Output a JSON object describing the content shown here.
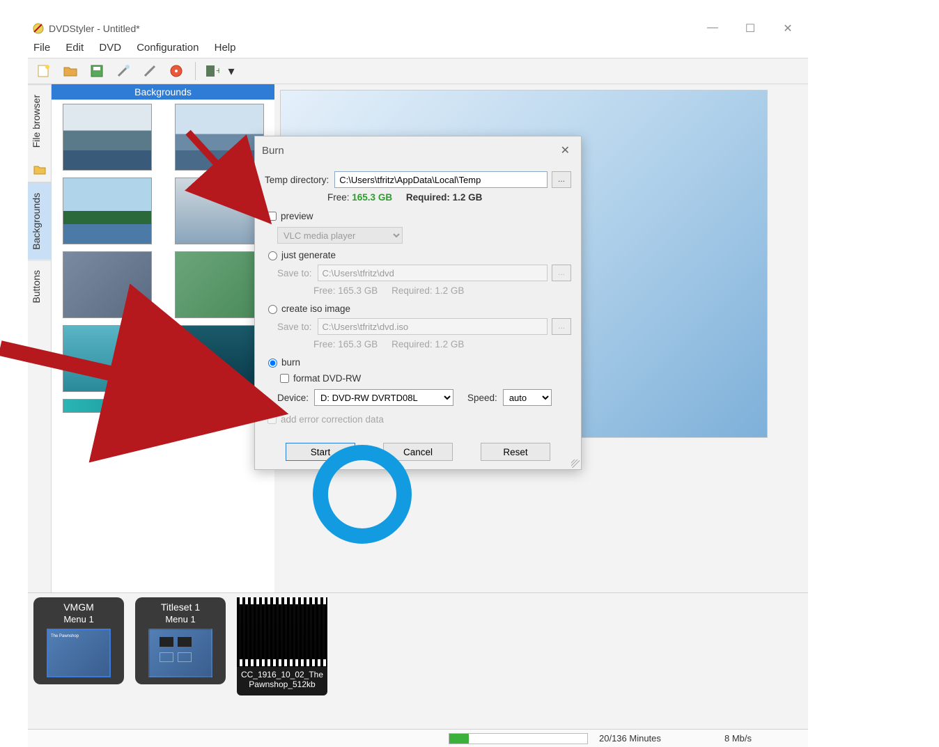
{
  "titlebar": {
    "title": "DVDStyler - Untitled*"
  },
  "menubar": {
    "items": [
      "File",
      "Edit",
      "DVD",
      "Configuration",
      "Help"
    ]
  },
  "side_tabs": {
    "file_browser": "File browser",
    "backgrounds": "Backgrounds",
    "buttons": "Buttons"
  },
  "bg_panel": {
    "header": "Backgrounds"
  },
  "bottom": {
    "vmgm": {
      "title": "VMGM",
      "sub": "Menu 1"
    },
    "titleset": {
      "title": "Titleset 1",
      "sub": "Menu 1"
    },
    "clip": {
      "name": "CC_1916_10_02_ThePawnshop_512kb"
    }
  },
  "status": {
    "time": "20/136 Minutes",
    "rate": "8 Mb/s"
  },
  "dialog": {
    "title": "Burn",
    "temp_label": "Temp directory:",
    "temp_path": "C:\\Users\\tfritz\\AppData\\Local\\Temp",
    "free_label": "Free:",
    "free_value": "165.3 GB",
    "req_label": "Required:",
    "req_value": "1.2 GB",
    "preview_label": "preview",
    "preview_player": "VLC media player",
    "just_generate_label": "just generate",
    "save_to_label": "Save to:",
    "just_gen_path": "C:\\Users\\tfritz\\dvd",
    "jg_free": "Free: 165.3 GB",
    "jg_req": "Required: 1.2 GB",
    "create_iso_label": "create iso image",
    "iso_path": "C:\\Users\\tfritz\\dvd.iso",
    "iso_free": "Free: 165.3 GB",
    "iso_req": "Required: 1.2 GB",
    "burn_label": "burn",
    "format_label": "format DVD-RW",
    "device_label": "Device:",
    "device_value": "D: DVD-RW  DVRTD08L",
    "speed_label": "Speed:",
    "speed_value": "auto",
    "ecc_label": "add error correction data",
    "start": "Start",
    "cancel": "Cancel",
    "reset": "Reset"
  }
}
